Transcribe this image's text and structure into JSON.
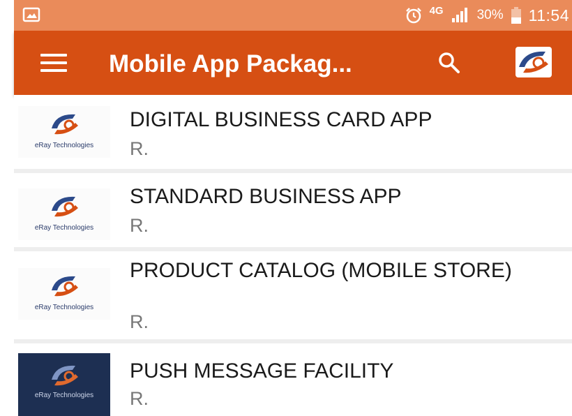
{
  "status_bar": {
    "network": "4G",
    "battery": "30%",
    "time": "11:54"
  },
  "app_bar": {
    "title": "Mobile App Packag..."
  },
  "items": [
    {
      "title": "DIGITAL BUSINESS CARD APP",
      "subtitle": "R.",
      "brand": "eRay Technologies"
    },
    {
      "title": "STANDARD BUSINESS APP",
      "subtitle": "R.",
      "brand": "eRay Technologies"
    },
    {
      "title": "PRODUCT CATALOG (MOBILE STORE)",
      "subtitle": "R.",
      "brand": "eRay Technologies"
    },
    {
      "title": "PUSH MESSAGE FACILITY",
      "subtitle": "R.",
      "brand": "eRay Technologies"
    }
  ],
  "colors": {
    "status_bar": "#ea8b5a",
    "app_bar": "#d64f13",
    "divider": "#eeeeee"
  },
  "icons": {
    "menu": "hamburger-menu-icon",
    "search": "magnifier-icon",
    "alarm": "alarm-clock-icon",
    "signal": "signal-strength-icon",
    "battery": "battery-icon",
    "gallery": "image-gallery-icon",
    "logo": "eray-logo-icon"
  }
}
